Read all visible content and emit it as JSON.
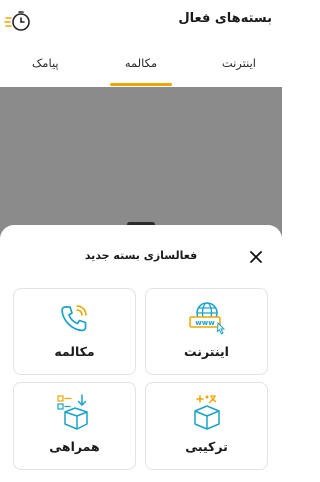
{
  "header": {
    "title": "بسته‌های فعال",
    "history_icon": "clock-history-icon"
  },
  "tabs": [
    {
      "label": "اینترنت"
    },
    {
      "label": "مکالمه"
    },
    {
      "label": "پیامک"
    }
  ],
  "sheet": {
    "title": "فعالسازی بسته جدید",
    "close_icon": "close-icon",
    "options": [
      {
        "label": "اینترنت",
        "icon": "globe-www-icon"
      },
      {
        "label": "مکالمه",
        "icon": "phone-call-icon"
      },
      {
        "label": "ترکیبی",
        "icon": "gift-box-icon"
      },
      {
        "label": "همراهی",
        "icon": "box-checklist-icon"
      }
    ]
  },
  "colors": {
    "accent": "#f0a500",
    "icon_blue": "#1aa3c8",
    "overlay": "#8b8b8b"
  }
}
